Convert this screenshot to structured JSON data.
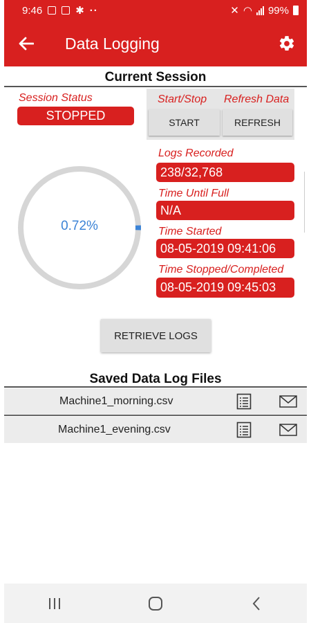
{
  "status_bar": {
    "time": "9:46",
    "dots": "··",
    "battery": "99%"
  },
  "app_bar": {
    "title": "Data Logging",
    "back_icon": "arrow-left-icon",
    "settings_icon": "gear-icon"
  },
  "current_session": {
    "title": "Current Session",
    "session_status_label": "Session Status",
    "session_status_value": "STOPPED",
    "start_stop_label": "Start/Stop",
    "refresh_label": "Refresh Data",
    "start_button": "START",
    "refresh_button": "REFRESH",
    "progress_text": "0.72%",
    "progress_fraction": 0.0072,
    "logs_recorded_label": "Logs Recorded",
    "logs_recorded_value": "238/32,768",
    "time_until_full_label": "Time Until Full",
    "time_until_full_value": "N/A",
    "time_started_label": "Time Started",
    "time_started_value": "08-05-2019 09:41:06",
    "time_stopped_label": "Time Stopped/Completed",
    "time_stopped_value": "08-05-2019 09:45:03",
    "retrieve_button": "RETRIEVE LOGS"
  },
  "saved_files": {
    "title": "Saved Data Log Files",
    "files": [
      {
        "name": "Machine1_morning.csv"
      },
      {
        "name": "Machine1_evening.csv"
      }
    ]
  },
  "colors": {
    "brand_red": "#d8201f",
    "progress_blue": "#3b83d6",
    "gauge_track": "#d6d6d6"
  }
}
